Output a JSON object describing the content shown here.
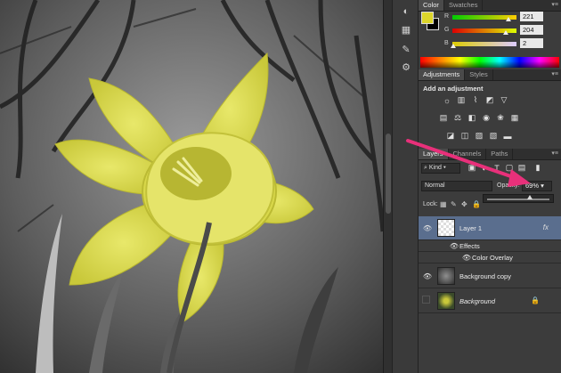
{
  "color_panel": {
    "tabs": [
      "Color",
      "Swatches"
    ],
    "channels": [
      {
        "letter": "R",
        "value": "221"
      },
      {
        "letter": "G",
        "value": "204"
      },
      {
        "letter": "B",
        "value": "2"
      }
    ],
    "foreground": "#dcd52a",
    "background": "#000000"
  },
  "adjustments_panel": {
    "tabs": [
      "Adjustments",
      "Styles"
    ],
    "heading": "Add an adjustment"
  },
  "layers_panel": {
    "tabs": [
      "Layers",
      "Channels",
      "Paths"
    ],
    "filter_kind": "Kind",
    "blend_mode": "Normal",
    "opacity_label": "Opacity:",
    "opacity_value": "69%",
    "opacity_level": 0.69,
    "lock_label": "Lock:",
    "layers": [
      {
        "name": "Layer 1",
        "fx": "fx",
        "selected": true
      },
      {
        "effects_label": "Effects",
        "effect": "Color Overlay"
      },
      {
        "name": "Background copy"
      },
      {
        "name": "Background",
        "locked": true
      }
    ]
  },
  "colors": {
    "accent_arrow": "#e8307a",
    "flower_yellow": "#d9d84a",
    "selected_layer": "#5a6e8e"
  }
}
